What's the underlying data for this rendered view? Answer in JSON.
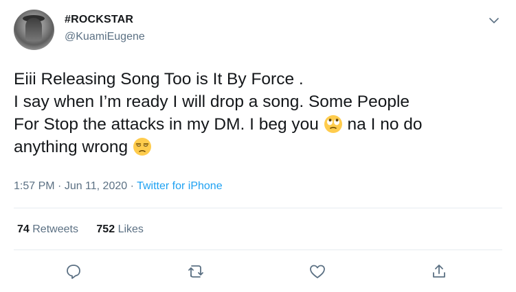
{
  "user": {
    "display_name": "#ROCKSTAR",
    "handle": "@KuamiEugene"
  },
  "tweet": {
    "line1": "Eiii Releasing Song Too is It By Force .",
    "line2": "I say when I’m ready I will drop a song. Some People",
    "line3a": "For Stop the attacks in my DM. I beg you ",
    "line3b": " na I no do",
    "line4a": "anything wrong ",
    "emoji1": "face-with-rolling-eyes",
    "emoji2": "unamused-face"
  },
  "meta": {
    "time": "1:57 PM",
    "sep1": " · ",
    "date": "Jun 11, 2020",
    "sep2": " · ",
    "source": "Twitter for iPhone"
  },
  "stats": {
    "retweets_count": "74",
    "retweets_label": "Retweets",
    "likes_count": "752",
    "likes_label": "Likes"
  },
  "actions": [
    "reply-icon",
    "retweet-icon",
    "like-icon",
    "share-icon"
  ],
  "colors": {
    "text": "#14171a",
    "secondary": "#5b7083",
    "link": "#1da1f2",
    "divider": "#e6ecf0"
  }
}
